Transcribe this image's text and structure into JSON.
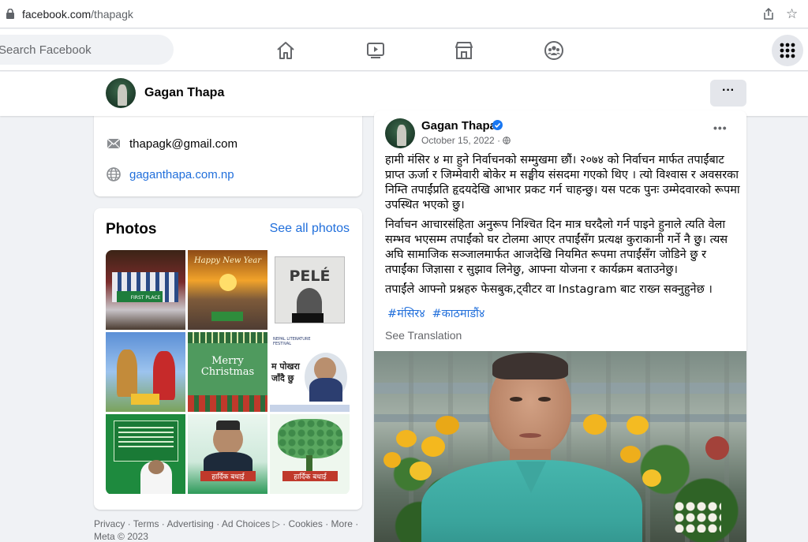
{
  "browser": {
    "url_domain": "facebook.com",
    "url_path": "/thapagk"
  },
  "nav": {
    "search_placeholder": "Search Facebook",
    "icons": [
      "home-icon",
      "watch-icon",
      "marketplace-icon",
      "groups-icon",
      "menu-grid-icon"
    ]
  },
  "profile": {
    "name": "Gagan Thapa",
    "more_label": "···"
  },
  "intro": {
    "email": "thapagk@gmail.com",
    "website": "gaganthapa.com.np"
  },
  "photos": {
    "title": "Photos",
    "see_all": "See all photos",
    "tiles": [
      {
        "caption": "FIRST PLACE"
      },
      {
        "caption": "Happy New Year"
      },
      {
        "caption": "PELÉ"
      },
      {
        "caption": ""
      },
      {
        "caption": "Merry Christmas"
      },
      {
        "caption": "NEPAL LITERATURE FESTIVAL"
      },
      {
        "caption": ""
      },
      {
        "caption": "हार्दिक बधाई"
      },
      {
        "caption": "हार्दिक बधाई"
      }
    ]
  },
  "footer": {
    "links": [
      "Privacy",
      "Terms",
      "Advertising",
      "Ad Choices",
      "Cookies",
      "More"
    ],
    "copyright": "Meta © 2023"
  },
  "post": {
    "author": "Gagan Thapa",
    "date": "October 15, 2022",
    "more_label": "•••",
    "paragraphs": [
      "हामी मंसिर ४ मा हुने निर्वाचनको सम्मुखमा छौं। २०७४ को निर्वाचन मार्फत तपाईंबाट प्राप्त ऊर्जा र जिम्मेवारी बोकेर म सङ्घीय संसदमा गएको थिए । त्यो विश्वास र अवसरका निम्ति तपाईंप्रति हृदयदेखि आभार प्रकट गर्न चाहन्छु। यस पटक पुनः उम्मेदवारको रूपमा उपस्थित भएको छु।",
      "निर्वाचन आचारसंहिता अनुरूप निश्चित दिन मात्र घरदैलो गर्न पाइने हुनाले त्यति वेला सम्भव भएसम्म तपाईंको घर टोलमा आएर तपाईंसँग प्रत्यक्ष कुराकानी गर्ने नै छु। त्यस अघि सामाजिक सञ्जालमार्फत आजदेखि नियमित रूपमा तपाईंसँग जोडिने छु र तपाईंका जिज्ञासा र सुझाव लिनेछु, आफ्ना योजना र कार्यक्रम बताउनेछु।",
      "तपाईंले आफ्नो प्रश्नहरु फेसबुक,ट्वीटर वा Instagram बाट राख्न सक्नुहुनेछ ।"
    ],
    "hashtags": [
      "#मंसिर४",
      "#काठमाडौं४"
    ],
    "see_translation": "See Translation"
  },
  "colors": {
    "link": "#216fdb",
    "fb_blue": "#1877f2",
    "background": "#f0f2f5"
  }
}
